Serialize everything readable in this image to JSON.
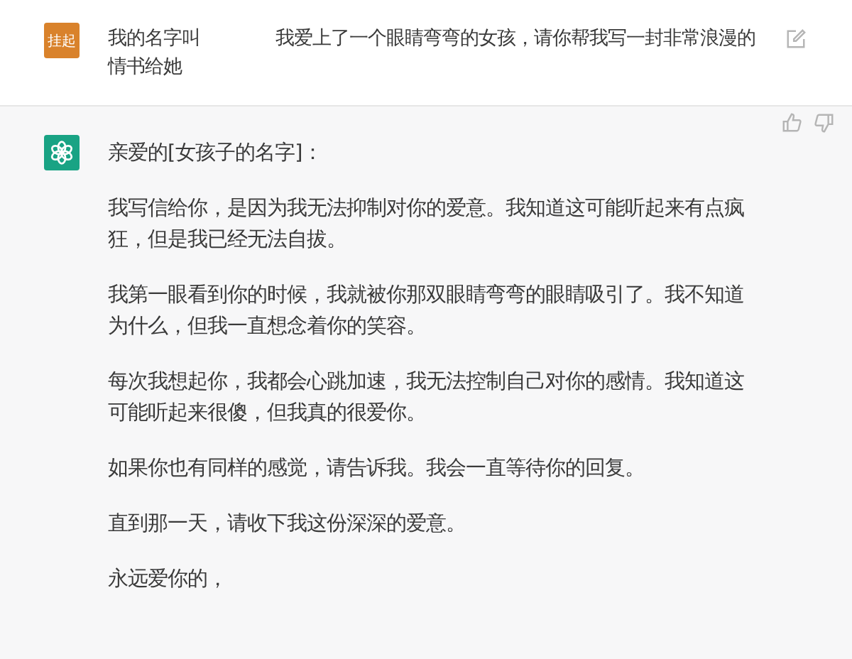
{
  "user_message": {
    "avatar": "挂起",
    "text_before_gap": "我的名字叫",
    "text_after_gap": "我爱上了一个眼睛弯弯的女孩，请你帮我写一封非常浪漫的情书给她"
  },
  "reply": {
    "greeting": "亲爱的[女孩子的名字]：",
    "paragraphs": [
      "我写信给你，是因为我无法抑制对你的爱意。我知道这可能听起来有点疯狂，但是我已经无法自拔。",
      "我第一眼看到你的时候，我就被你那双眼睛弯弯的眼睛吸引了。我不知道为什么，但我一直想念着你的笑容。",
      "每次我想起你，我都会心跳加速，我无法控制自己对你的感情。我知道这可能听起来很傻，但我真的很爱你。",
      "如果你也有同样的感觉，请告诉我。我会一直等待你的回复。",
      "直到那一天，请收下我这份深深的爱意。",
      "永远爱你的，"
    ]
  }
}
